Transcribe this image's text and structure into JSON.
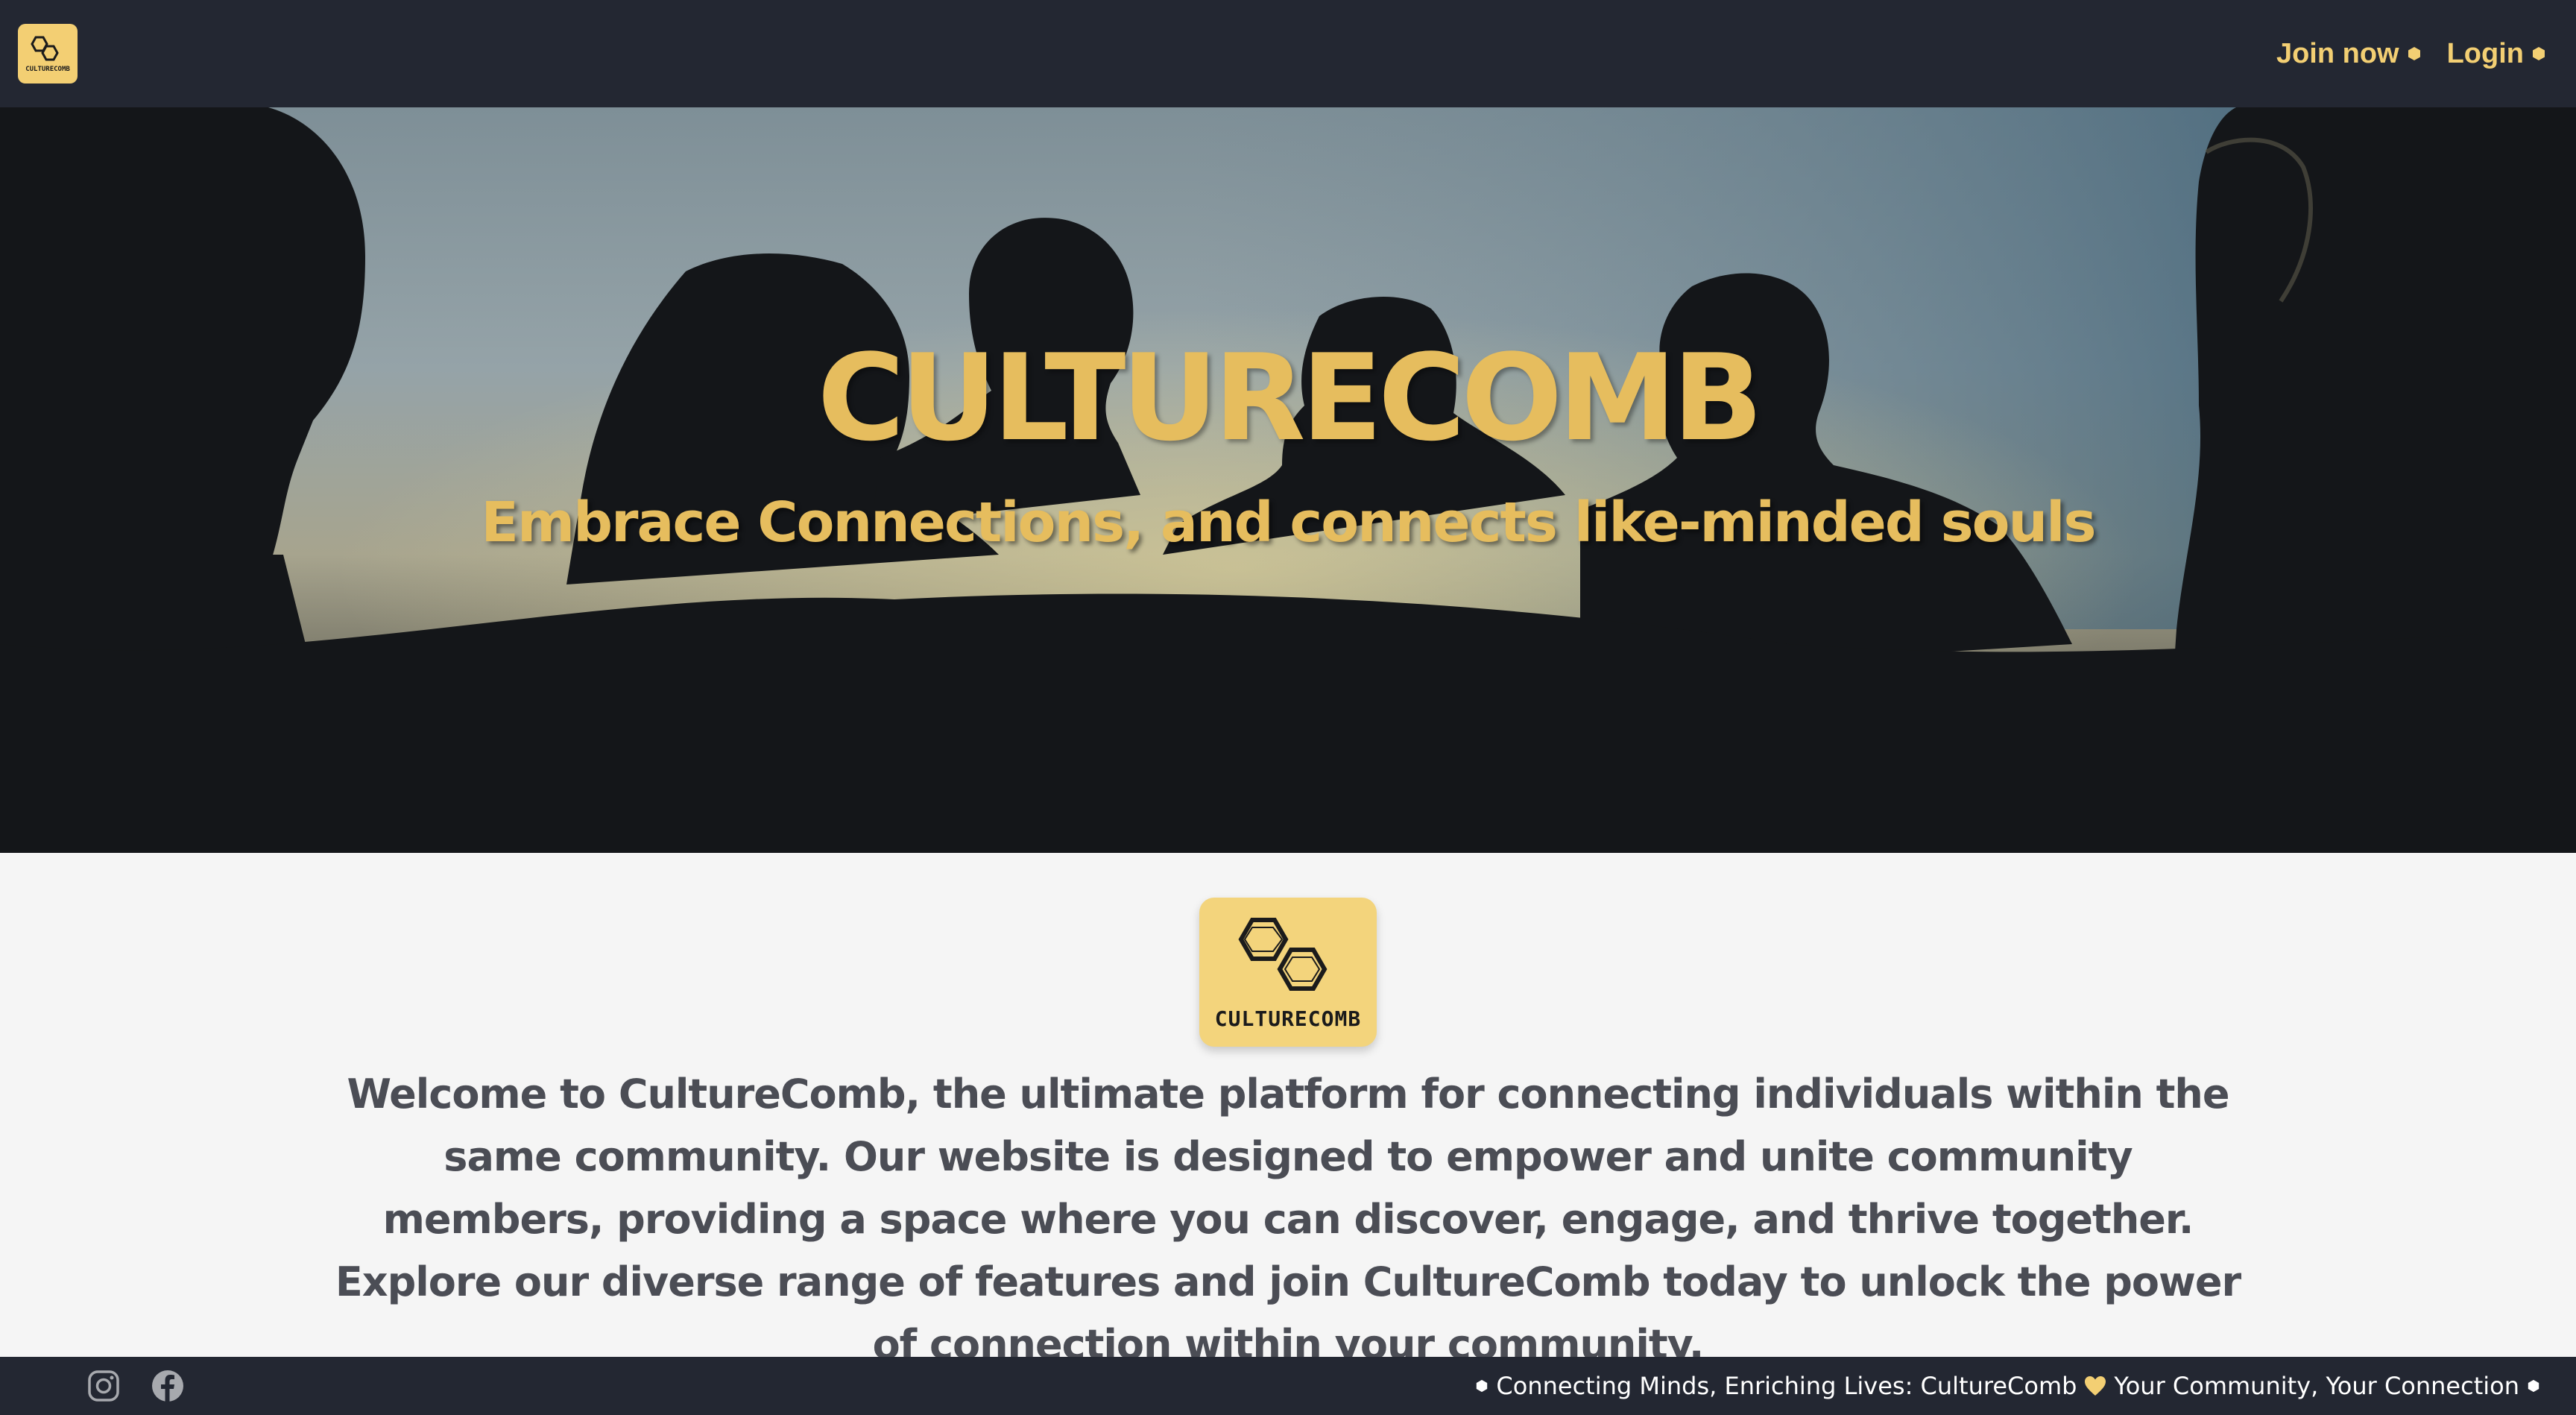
{
  "nav": {
    "logo_text": "CULTURECOMB",
    "join_label": "Join now",
    "login_label": "Login"
  },
  "hero": {
    "title": "CULTURECOMB",
    "subtitle": "Embrace Connections, and connects like-minded souls"
  },
  "content": {
    "logo_text": "CULTURECOMB",
    "welcome": "Welcome to CultureComb, the ultimate platform for connecting individuals within the same community. Our website is designed to empower and unite community members, providing a space where you can discover, engage, and thrive together. Explore our diverse range of features and join CultureComb today to unlock the power of connection within your community."
  },
  "footer": {
    "tagline_left": "Connecting Minds, Enriching Lives: CultureComb",
    "tagline_right": "Your Community, Your Connection",
    "social_icons": [
      "instagram-icon",
      "facebook-icon"
    ]
  },
  "colors": {
    "nav_bg": "#232732",
    "accent": "#f3cf73",
    "hero_text": "#e6bd5e",
    "body_text": "#4b4d55",
    "page_bg": "#f5f5f5"
  }
}
